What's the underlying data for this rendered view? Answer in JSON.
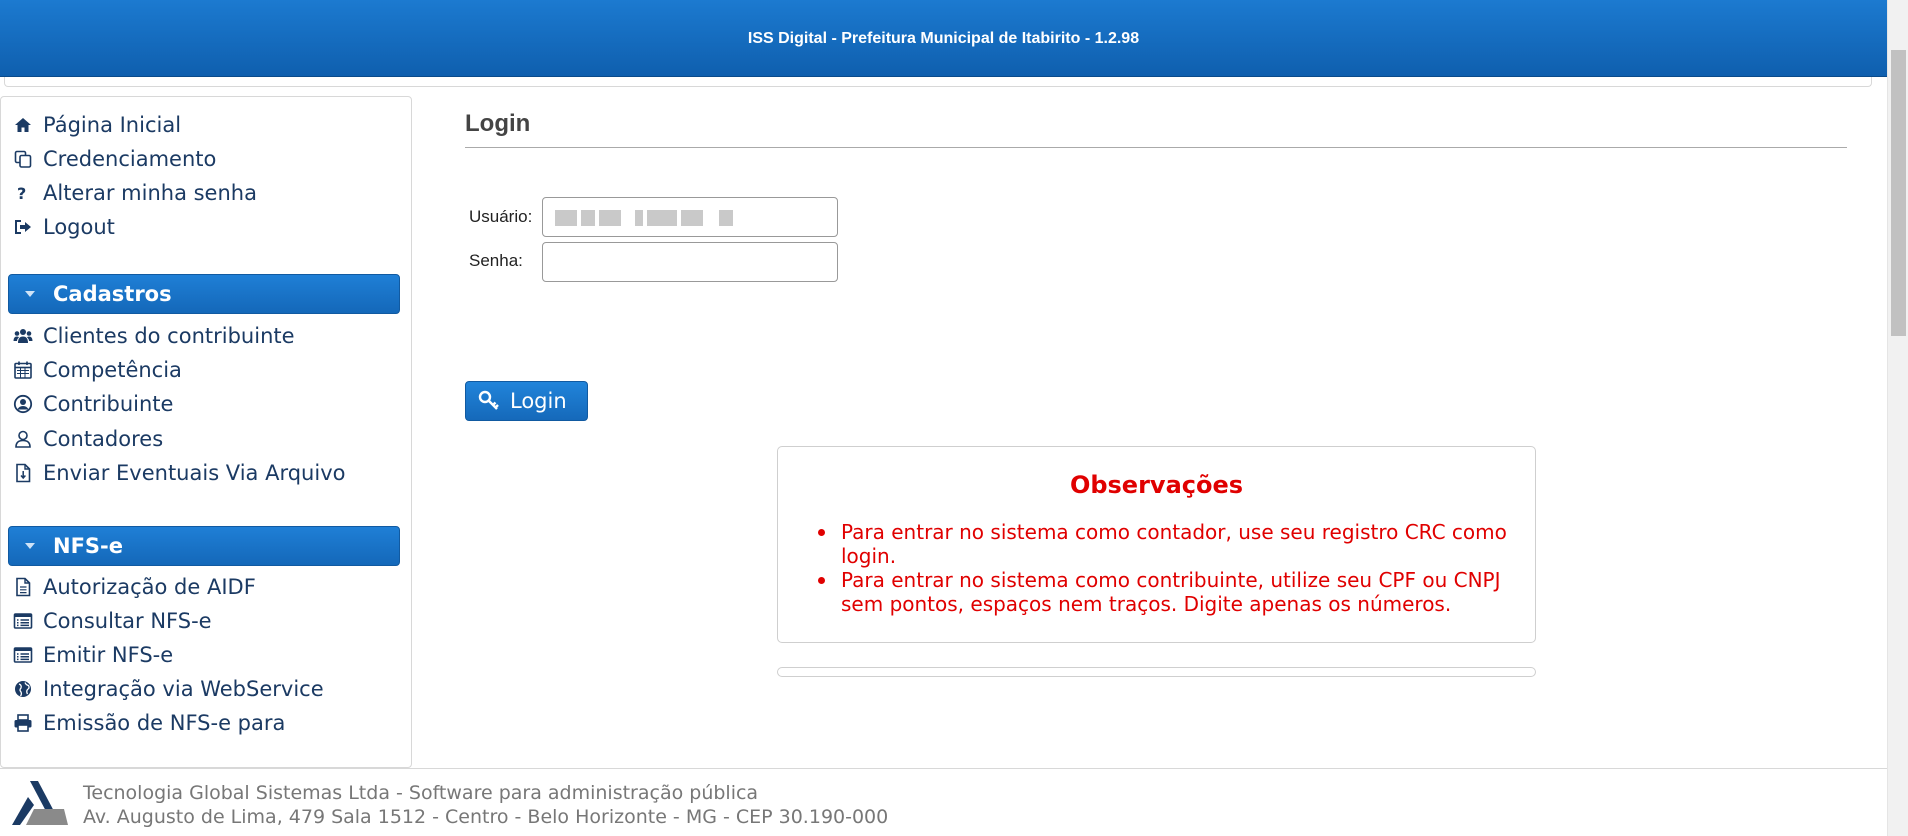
{
  "header": {
    "title": "ISS Digital - Prefeitura Municipal de Itabirito - 1.2.98"
  },
  "sidebar": {
    "items_top": [
      {
        "label": "Página Inicial",
        "icon": "home-icon"
      },
      {
        "label": "Credenciamento",
        "icon": "copy-icon"
      },
      {
        "label": "Alterar minha senha",
        "icon": "question-icon"
      },
      {
        "label": "Logout",
        "icon": "sign-out-icon"
      }
    ],
    "section_cadastros": "Cadastros",
    "items_cadastros": [
      {
        "label": "Clientes do contribuinte",
        "icon": "users-icon"
      },
      {
        "label": "Competência",
        "icon": "calendar-icon"
      },
      {
        "label": "Contribuinte",
        "icon": "user-circle-icon"
      },
      {
        "label": "Contadores",
        "icon": "user-icon"
      },
      {
        "label": "Enviar Eventuais Via Arquivo",
        "icon": "file-upload-icon"
      }
    ],
    "section_nfse": "NFS-e",
    "items_nfse": [
      {
        "label": "Autorização de AIDF",
        "icon": "document-icon"
      },
      {
        "label": "Consultar NFS-e",
        "icon": "list-icon"
      },
      {
        "label": "Emitir NFS-e",
        "icon": "list-icon"
      },
      {
        "label": "Integração via WebService",
        "icon": "globe-icon"
      },
      {
        "label": "Emissão de NFS-e para",
        "icon": "print-icon"
      }
    ]
  },
  "main": {
    "title": "Login",
    "username_label": "Usuário:",
    "password_label": "Senha:",
    "login_button": "Login"
  },
  "observacoes": {
    "title": "Observações",
    "items": [
      "Para entrar no sistema como contador, use seu registro CRC como login.",
      "Para entrar no sistema como contribuinte, utilize seu CPF ou CNPJ sem pontos, espaços nem traços. Digite apenas os números."
    ]
  },
  "footer": {
    "line1": "Tecnologia Global Sistemas Ltda - Software para administração pública",
    "line2": "Av. Augusto de Lima, 479 Sala 1512 - Centro - Belo Horizonte - MG - CEP 30.190-000"
  },
  "colors": {
    "header_blue": "#1468b9",
    "accent_red": "#e00000",
    "link_navy": "#1b3a63"
  }
}
